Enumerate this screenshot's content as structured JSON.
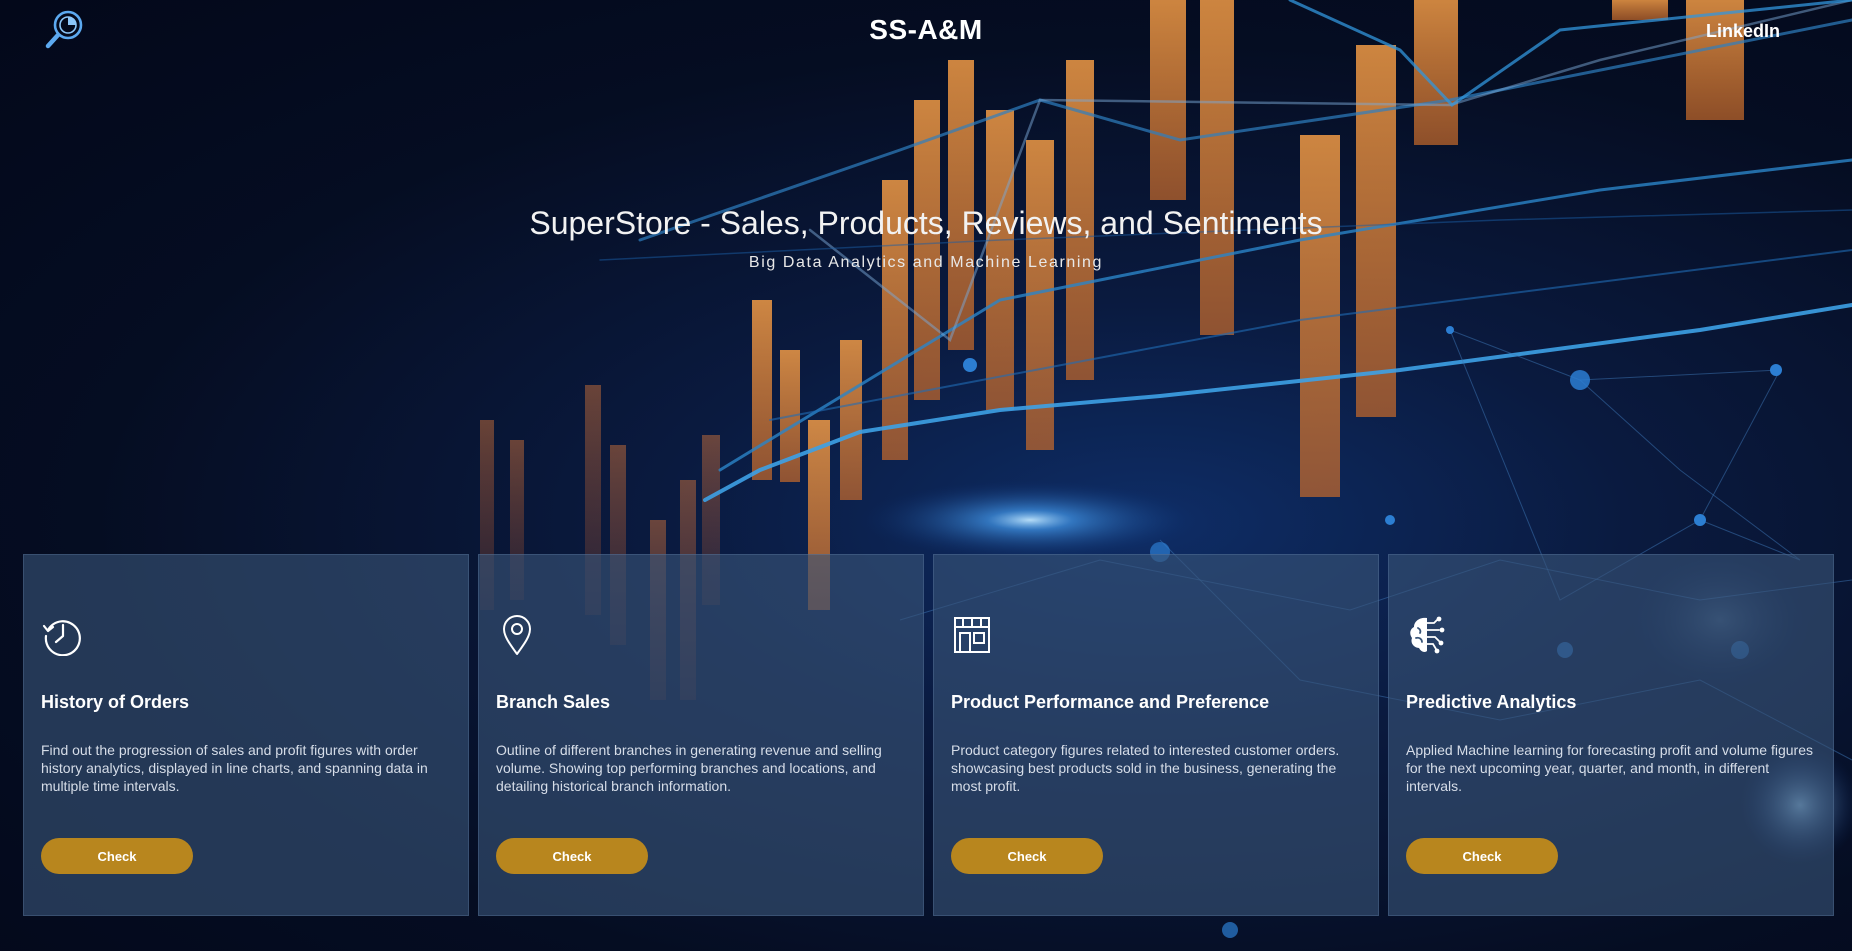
{
  "header": {
    "logo_icon": "magnifier-analytics-icon",
    "brand": "SS-A&M",
    "nav_link": "LinkedIn"
  },
  "hero": {
    "title": "SuperStore - Sales, Products, Reviews, and Sentiments",
    "subtitle": "Big Data Analytics and Machine Learning"
  },
  "cards": [
    {
      "icon": "history-clock-icon",
      "title": "History of Orders",
      "description": "Find out the progression of sales and profit figures with order history analytics, displayed in line charts, and spanning data in multiple time intervals.",
      "button": "Check"
    },
    {
      "icon": "map-pin-icon",
      "title": "Branch Sales",
      "description": "Outline of different branches in generating revenue and selling volume. Showing top performing branches and locations, and detailing historical branch information.",
      "button": "Check"
    },
    {
      "icon": "storefront-icon",
      "title": "Product Performance and Preference",
      "description": "Product category figures related to interested customer orders. showcasing best products sold in the business, generating the most profit.",
      "button": "Check"
    },
    {
      "icon": "brain-circuit-icon",
      "title": "Predictive Analytics",
      "description": "Applied Machine learning for forecasting profit and volume figures for the next upcoming year, quarter, and month, in different intervals.",
      "button": "Check"
    }
  ],
  "colors": {
    "accent_button": "#b8861e",
    "card_background": "#385478",
    "background": "#04091a",
    "bar_orange": "#e08a3a",
    "line_blue": "#2a8fd8"
  }
}
